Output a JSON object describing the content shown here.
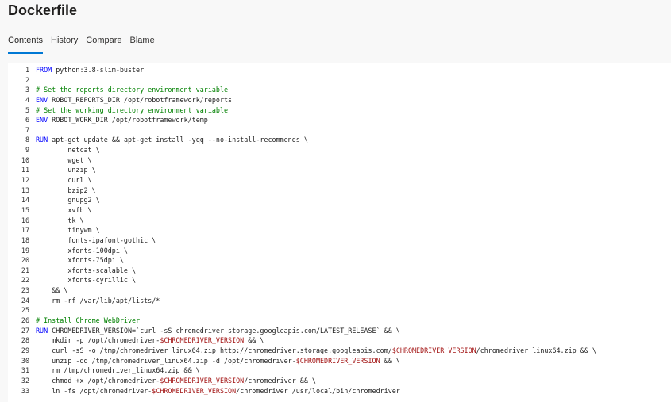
{
  "file": {
    "title": "Dockerfile"
  },
  "tabs": [
    {
      "label": "Contents",
      "active": true
    },
    {
      "label": "History",
      "active": false
    },
    {
      "label": "Compare",
      "active": false
    },
    {
      "label": "Blame",
      "active": false
    }
  ],
  "colors": {
    "accent": "#0078d4",
    "keyword": "#0000ff",
    "comment": "#008000",
    "variable": "#a31515"
  },
  "code": {
    "lines": [
      {
        "n": "1",
        "segs": [
          [
            "kw",
            "FROM"
          ],
          [
            "txt",
            " python:3.8-slim-buster"
          ]
        ]
      },
      {
        "n": "2",
        "segs": []
      },
      {
        "n": "3",
        "segs": [
          [
            "cm",
            "# Set the reports directory environment variable"
          ]
        ]
      },
      {
        "n": "4",
        "segs": [
          [
            "kw",
            "ENV"
          ],
          [
            "txt",
            " ROBOT_REPORTS_DIR /opt/robotframework/reports"
          ]
        ]
      },
      {
        "n": "5",
        "segs": [
          [
            "cm",
            "# Set the working directory environment variable"
          ]
        ]
      },
      {
        "n": "6",
        "segs": [
          [
            "kw",
            "ENV"
          ],
          [
            "txt",
            " ROBOT_WORK_DIR /opt/robotframework/temp"
          ]
        ]
      },
      {
        "n": "7",
        "segs": []
      },
      {
        "n": "8",
        "segs": [
          [
            "kw",
            "RUN"
          ],
          [
            "txt",
            " apt-get update && apt-get install -yqq --no-install-recommends \\"
          ]
        ]
      },
      {
        "n": "9",
        "segs": [
          [
            "txt",
            "        netcat \\"
          ]
        ]
      },
      {
        "n": "10",
        "segs": [
          [
            "txt",
            "        wget \\"
          ]
        ]
      },
      {
        "n": "11",
        "segs": [
          [
            "txt",
            "        unzip \\"
          ]
        ]
      },
      {
        "n": "12",
        "segs": [
          [
            "txt",
            "        curl \\"
          ]
        ]
      },
      {
        "n": "13",
        "segs": [
          [
            "txt",
            "        bzip2 \\"
          ]
        ]
      },
      {
        "n": "14",
        "segs": [
          [
            "txt",
            "        gnupg2 \\"
          ]
        ]
      },
      {
        "n": "15",
        "segs": [
          [
            "txt",
            "        xvfb \\"
          ]
        ]
      },
      {
        "n": "16",
        "segs": [
          [
            "txt",
            "        tk \\"
          ]
        ]
      },
      {
        "n": "17",
        "segs": [
          [
            "txt",
            "        tinywm \\"
          ]
        ]
      },
      {
        "n": "18",
        "segs": [
          [
            "txt",
            "        fonts-ipafont-gothic \\"
          ]
        ]
      },
      {
        "n": "19",
        "segs": [
          [
            "txt",
            "        xfonts-100dpi \\"
          ]
        ]
      },
      {
        "n": "20",
        "segs": [
          [
            "txt",
            "        xfonts-75dpi \\"
          ]
        ]
      },
      {
        "n": "21",
        "segs": [
          [
            "txt",
            "        xfonts-scalable \\"
          ]
        ]
      },
      {
        "n": "22",
        "segs": [
          [
            "txt",
            "        xfonts-cyrillic \\"
          ]
        ]
      },
      {
        "n": "23",
        "segs": [
          [
            "txt",
            "    && \\"
          ]
        ]
      },
      {
        "n": "24",
        "segs": [
          [
            "txt",
            "    rm -rf /var/lib/apt/lists/*"
          ]
        ]
      },
      {
        "n": "25",
        "segs": []
      },
      {
        "n": "26",
        "segs": [
          [
            "cm",
            "# Install Chrome WebDriver"
          ]
        ]
      },
      {
        "n": "27",
        "segs": [
          [
            "kw",
            "RUN"
          ],
          [
            "txt",
            " CHROMEDRIVER_VERSION=`curl -sS chromedriver.storage.googleapis.com/LATEST_RELEASE` && \\"
          ]
        ]
      },
      {
        "n": "28",
        "segs": [
          [
            "txt",
            "    mkdir -p /opt/chromedriver-"
          ],
          [
            "var",
            "$CHROMEDRIVER_VERSION"
          ],
          [
            "txt",
            " && \\"
          ]
        ]
      },
      {
        "n": "29",
        "segs": [
          [
            "txt",
            "    curl -sS -o /tmp/chromedriver_linux64.zip "
          ],
          [
            "url",
            "http://chromedriver.storage.googleapis.com/"
          ],
          [
            "var",
            "$CHROMEDRIVER_VERSION"
          ],
          [
            "url",
            "/chromedriver_linux64.zip"
          ],
          [
            "txt",
            " && \\"
          ]
        ]
      },
      {
        "n": "30",
        "segs": [
          [
            "txt",
            "    unzip -qq /tmp/chromedriver_linux64.zip -d /opt/chromedriver-"
          ],
          [
            "var",
            "$CHROMEDRIVER_VERSION"
          ],
          [
            "txt",
            " && \\"
          ]
        ]
      },
      {
        "n": "31",
        "segs": [
          [
            "txt",
            "    rm /tmp/chromedriver_linux64.zip && \\"
          ]
        ]
      },
      {
        "n": "32",
        "segs": [
          [
            "txt",
            "    chmod +x /opt/chromedriver-"
          ],
          [
            "var",
            "$CHROMEDRIVER_VERSION"
          ],
          [
            "txt",
            "/chromedriver && \\"
          ]
        ]
      },
      {
        "n": "33",
        "segs": [
          [
            "txt",
            "    ln -fs /opt/chromedriver-"
          ],
          [
            "var",
            "$CHROMEDRIVER_VERSION"
          ],
          [
            "txt",
            "/chromedriver /usr/local/bin/chromedriver"
          ]
        ]
      }
    ]
  }
}
